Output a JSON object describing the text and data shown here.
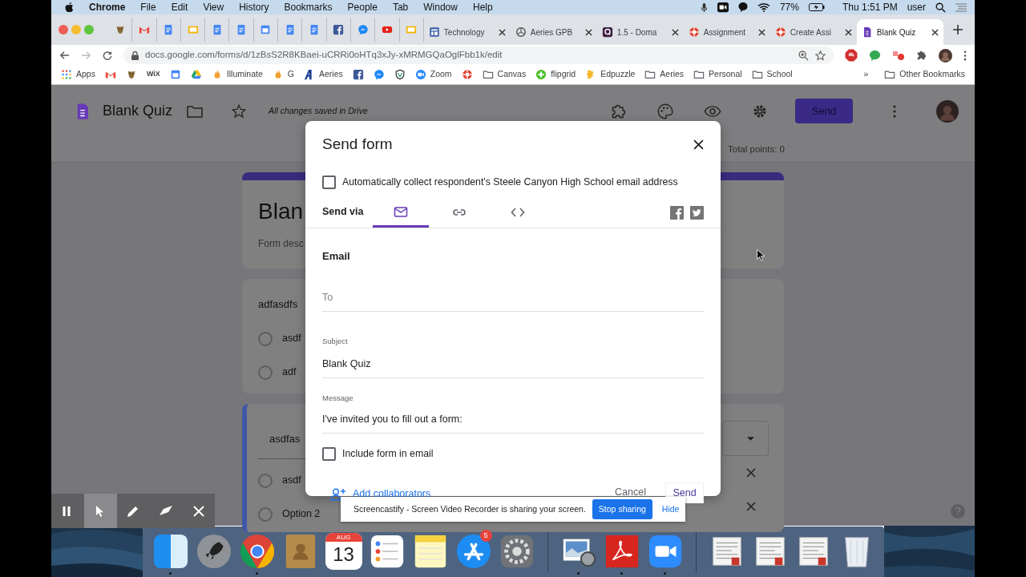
{
  "menu_bar": {
    "app": "Chrome",
    "items": [
      "File",
      "Edit",
      "View",
      "History",
      "Bookmarks",
      "People",
      "Tab",
      "Window",
      "Help"
    ],
    "battery": "77%",
    "clock": "Thu 1:51 PM",
    "user": "user"
  },
  "tabs": [
    {
      "kind": "mascot",
      "selected": false
    },
    {
      "kind": "mail",
      "selected": false
    },
    {
      "kind": "doc",
      "selected": false
    },
    {
      "kind": "slides",
      "selected": false
    },
    {
      "kind": "doc",
      "selected": false
    },
    {
      "kind": "doc",
      "selected": false
    },
    {
      "kind": "calendar",
      "selected": false
    },
    {
      "kind": "doc",
      "selected": false
    },
    {
      "kind": "doc",
      "selected": false
    },
    {
      "kind": "facebook",
      "selected": false
    },
    {
      "kind": "messenger",
      "selected": false
    },
    {
      "kind": "video",
      "selected": false
    },
    {
      "kind": "slides",
      "selected": false
    },
    {
      "kind": "window",
      "label": "Technology",
      "selected": false
    },
    {
      "kind": "aperture",
      "label": "Aeries GPB",
      "selected": false
    },
    {
      "kind": "app",
      "label": "1.5 - Doma",
      "selected": false
    },
    {
      "kind": "ring",
      "label": "Assignment",
      "selected": false
    },
    {
      "kind": "ring",
      "label": "Create Assi",
      "selected": false
    },
    {
      "kind": "form",
      "label": "Blank Quiz",
      "selected": true
    }
  ],
  "address": "docs.google.com/forms/d/1zBsS2R8KBaei-uCRRi0oHTq3xJy-xMRMGQaOglFbb1k/edit",
  "bookmarks": [
    {
      "kind": "apps",
      "label": "Apps"
    },
    {
      "kind": "mail"
    },
    {
      "kind": "mascot"
    },
    {
      "kind": "plain",
      "label": "WiX"
    },
    {
      "kind": "calendar"
    },
    {
      "kind": "drive"
    },
    {
      "kind": "flame",
      "label": "Illuminate"
    },
    {
      "kind": "flame",
      "label": "G"
    },
    {
      "kind": "logo",
      "label": "Aeries"
    },
    {
      "kind": "facebook"
    },
    {
      "kind": "messenger"
    },
    {
      "kind": "shield"
    },
    {
      "kind": "camera",
      "label": "Zoom"
    },
    {
      "kind": "ring"
    },
    {
      "kind": "folder",
      "label": "Canvas"
    },
    {
      "kind": "plus",
      "label": "flipgrid"
    },
    {
      "kind": "puzzle",
      "label": "Edpuzzle"
    },
    {
      "kind": "folder",
      "label": "Aeries"
    },
    {
      "kind": "folder",
      "label": "Personal"
    },
    {
      "kind": "folder",
      "label": "School"
    }
  ],
  "bookmarks_overflow": "»",
  "other_bookmarks": "Other Bookmarks",
  "form": {
    "title": "Blank Quiz",
    "save_status": "All changes saved in Drive",
    "send": "Send",
    "total_points": "Total points: 0",
    "header_title": "Blan",
    "description": "Form desc",
    "questions": [
      {
        "title": "adfasdfs",
        "editing": false,
        "options": [
          "asdf",
          "adf"
        ]
      },
      {
        "title": "asdfas",
        "editing": true,
        "options": [
          "asdf",
          "Option 2"
        ]
      }
    ]
  },
  "dialog": {
    "title": "Send form",
    "collect_email": {
      "label": "Automatically collect respondent's Steele Canyon High School email address",
      "checked": false
    },
    "send_via": "Send via",
    "methods": [
      {
        "kind": "email",
        "selected": true
      },
      {
        "kind": "link",
        "selected": false
      },
      {
        "kind": "embed",
        "selected": false
      }
    ],
    "section": "Email",
    "to": {
      "placeholder": "To"
    },
    "subject": {
      "label": "Subject",
      "value": "Blank Quiz"
    },
    "message": {
      "label": "Message",
      "value": "I've invited you to fill out a form:"
    },
    "include_form": {
      "label": "Include form in email",
      "checked": false
    },
    "add_collaborators": "Add collaborators",
    "cancel": "Cancel",
    "send": "Send"
  },
  "sharing_bar": {
    "text": "Screencastify - Screen Video Recorder is sharing your screen.",
    "stop": "Stop sharing",
    "hide": "Hide"
  },
  "recorder_tools": [
    {
      "kind": "pause",
      "selected": false
    },
    {
      "kind": "pointer",
      "selected": true
    },
    {
      "kind": "pen",
      "selected": false
    },
    {
      "kind": "eraser",
      "selected": false
    },
    {
      "kind": "close",
      "selected": false
    }
  ],
  "dock": [
    {
      "kind": "finder",
      "running": true
    },
    {
      "kind": "rocket",
      "running": false
    },
    {
      "kind": "chrome",
      "running": true
    },
    {
      "kind": "contacts",
      "running": false
    },
    {
      "kind": "calendar",
      "month": "AUG",
      "day": "13",
      "running": false
    },
    {
      "kind": "reminders",
      "running": false
    },
    {
      "kind": "notes",
      "running": false
    },
    {
      "kind": "appstore",
      "badge": "5",
      "running": false
    },
    {
      "kind": "settings",
      "running": false
    },
    {
      "kind": "separator"
    },
    {
      "kind": "preview",
      "running": true
    },
    {
      "kind": "acrobat",
      "running": true
    },
    {
      "kind": "zoom",
      "running": true
    },
    {
      "kind": "separator"
    },
    {
      "kind": "document",
      "running": false
    },
    {
      "kind": "document",
      "running": false
    },
    {
      "kind": "document",
      "running": false
    },
    {
      "kind": "trash",
      "running": false
    }
  ]
}
